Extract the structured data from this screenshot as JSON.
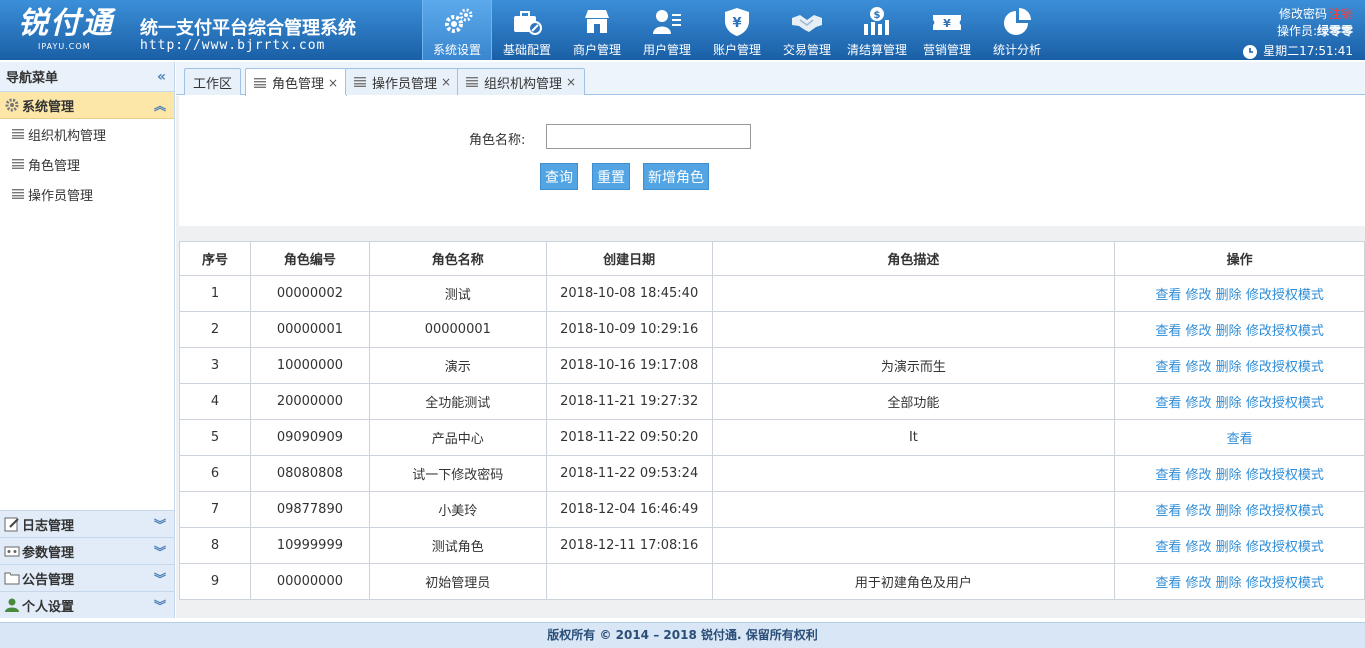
{
  "brand": {
    "logo_text": "锐付通",
    "logo_sub": "IPAYU.COM",
    "system_title": "统一支付平台综合管理系统",
    "url": "http://www.bjrrtx.com"
  },
  "topnav": [
    {
      "label": "系统设置",
      "icon": "gears-icon",
      "active": true
    },
    {
      "label": "基础配置",
      "icon": "toolbox-icon"
    },
    {
      "label": "商户管理",
      "icon": "store-icon"
    },
    {
      "label": "用户管理",
      "icon": "user-card-icon"
    },
    {
      "label": "账户管理",
      "icon": "shield-yen-icon"
    },
    {
      "label": "交易管理",
      "icon": "handshake-icon"
    },
    {
      "label": "清结算管理",
      "icon": "dollar-chart-icon"
    },
    {
      "label": "营销管理",
      "icon": "ticket-yen-icon"
    },
    {
      "label": "统计分析",
      "icon": "pie-chart-icon"
    }
  ],
  "user": {
    "change_password": "修改密码",
    "logout": "注销",
    "operator_label": "操作员:",
    "operator_name": "绿零零",
    "datetime": "星期二17:51:41"
  },
  "sidebar": {
    "title": "导航菜单",
    "active_group": {
      "label": "系统管理",
      "items": [
        "组织机构管理",
        "角色管理",
        "操作员管理"
      ]
    },
    "collapsed_groups": [
      {
        "label": "日志管理",
        "icon": "edit-icon"
      },
      {
        "label": "参数管理",
        "icon": "params-icon"
      },
      {
        "label": "公告管理",
        "icon": "folder-icon"
      },
      {
        "label": "个人设置",
        "icon": "person-icon"
      }
    ]
  },
  "tabs": {
    "workspace": "工作区",
    "role": "角色管理",
    "operator": "操作员管理",
    "org": "组织机构管理",
    "close": "×"
  },
  "search": {
    "label": "角色名称:",
    "value": "",
    "placeholder": "",
    "query_btn": "查询",
    "reset_btn": "重置",
    "add_btn": "新增角色"
  },
  "table": {
    "headers": [
      "序号",
      "角色编号",
      "角色名称",
      "创建日期",
      "角色描述",
      "操作"
    ],
    "action_labels": {
      "view": "查看",
      "edit": "修改",
      "delete": "删除",
      "auth": "修改授权模式"
    },
    "rows": [
      {
        "no": "1",
        "code": "00000002",
        "name": "测试",
        "date": "2018-10-08 18:45:40",
        "desc": "",
        "full_actions": true
      },
      {
        "no": "2",
        "code": "00000001",
        "name": "00000001",
        "date": "2018-10-09 10:29:16",
        "desc": "",
        "full_actions": true
      },
      {
        "no": "3",
        "code": "10000000",
        "name": "演示",
        "date": "2018-10-16 19:17:08",
        "desc": "为演示而生",
        "full_actions": true
      },
      {
        "no": "4",
        "code": "20000000",
        "name": "全功能测试",
        "date": "2018-11-21 19:27:32",
        "desc": "全部功能",
        "full_actions": true
      },
      {
        "no": "5",
        "code": "09090909",
        "name": "产品中心",
        "date": "2018-11-22 09:50:20",
        "desc": "It",
        "full_actions": false
      },
      {
        "no": "6",
        "code": "08080808",
        "name": "试一下修改密码",
        "date": "2018-11-22 09:53:24",
        "desc": "",
        "full_actions": true
      },
      {
        "no": "7",
        "code": "09877890",
        "name": "小美玲",
        "date": "2018-12-04 16:46:49",
        "desc": "",
        "full_actions": true
      },
      {
        "no": "8",
        "code": "10999999",
        "name": "测试角色",
        "date": "2018-12-11 17:08:16",
        "desc": "",
        "full_actions": true
      },
      {
        "no": "9",
        "code": "00000000",
        "name": "初始管理员",
        "date": "",
        "desc": "用于初建角色及用户",
        "full_actions": true
      }
    ]
  },
  "footer": "版权所有 © 2014 – 2018 锐付通. 保留所有权利",
  "colors": {
    "header_top": "#3b8fd8",
    "header_bottom": "#1a5fa6",
    "button": "#53a4e3",
    "link": "#2f8dd6",
    "active_group": "#fde7a8",
    "logout": "#ff3b30"
  }
}
